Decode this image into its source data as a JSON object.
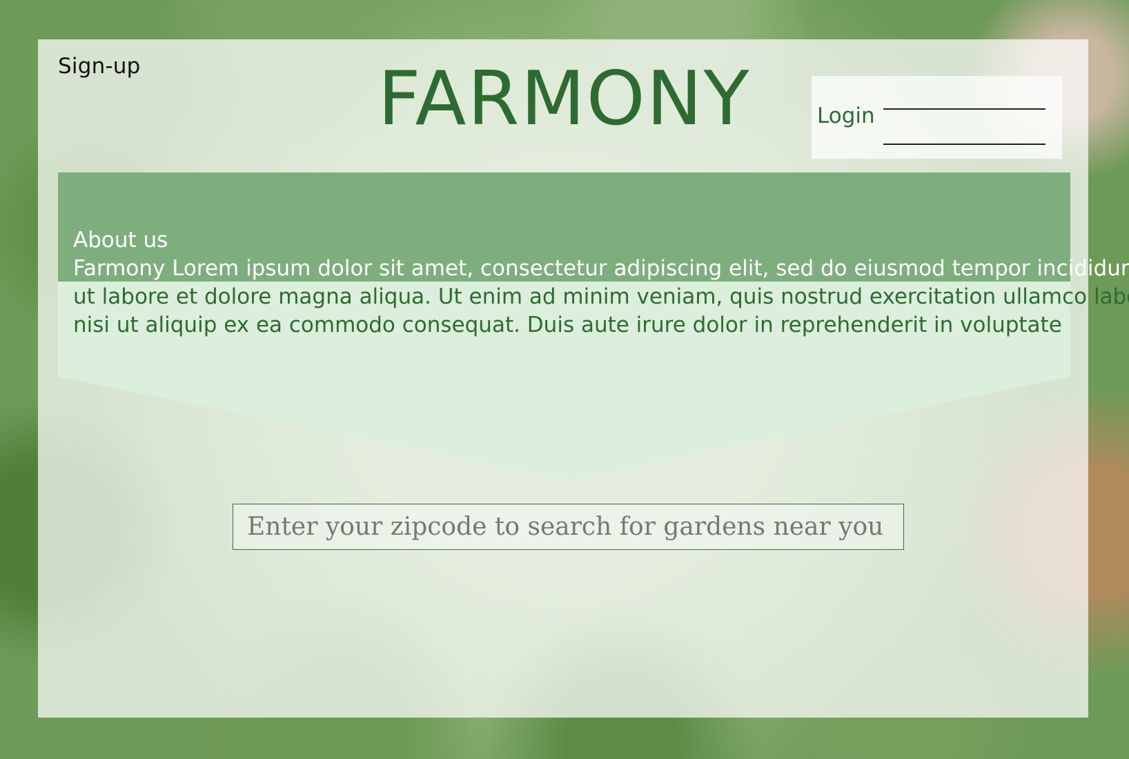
{
  "header": {
    "signup_label": "Sign-up",
    "brand": "FARMONY",
    "login_label": "Login"
  },
  "about": {
    "title": "About us",
    "lines": [
      "Farmony Lorem ipsum dolor sit amet, consectetur adipiscing elit, sed do eiusmod tempor incididunt",
      "ut labore et dolore magna aliqua. Ut enim ad minim veniam, quis nostrud exercitation ullamco laboris",
      "nisi ut aliquip ex ea commodo consequat. Duis aute irure dolor in reprehenderit in voluptate"
    ]
  },
  "search": {
    "placeholder": "Enter your zipcode to search for gardens near you ....",
    "value": ""
  },
  "colors": {
    "brand_green": "#2e6b32",
    "banner_dark": "#7eae7e",
    "banner_light": "#dceedc"
  },
  "background_image": "artichokes-photo"
}
